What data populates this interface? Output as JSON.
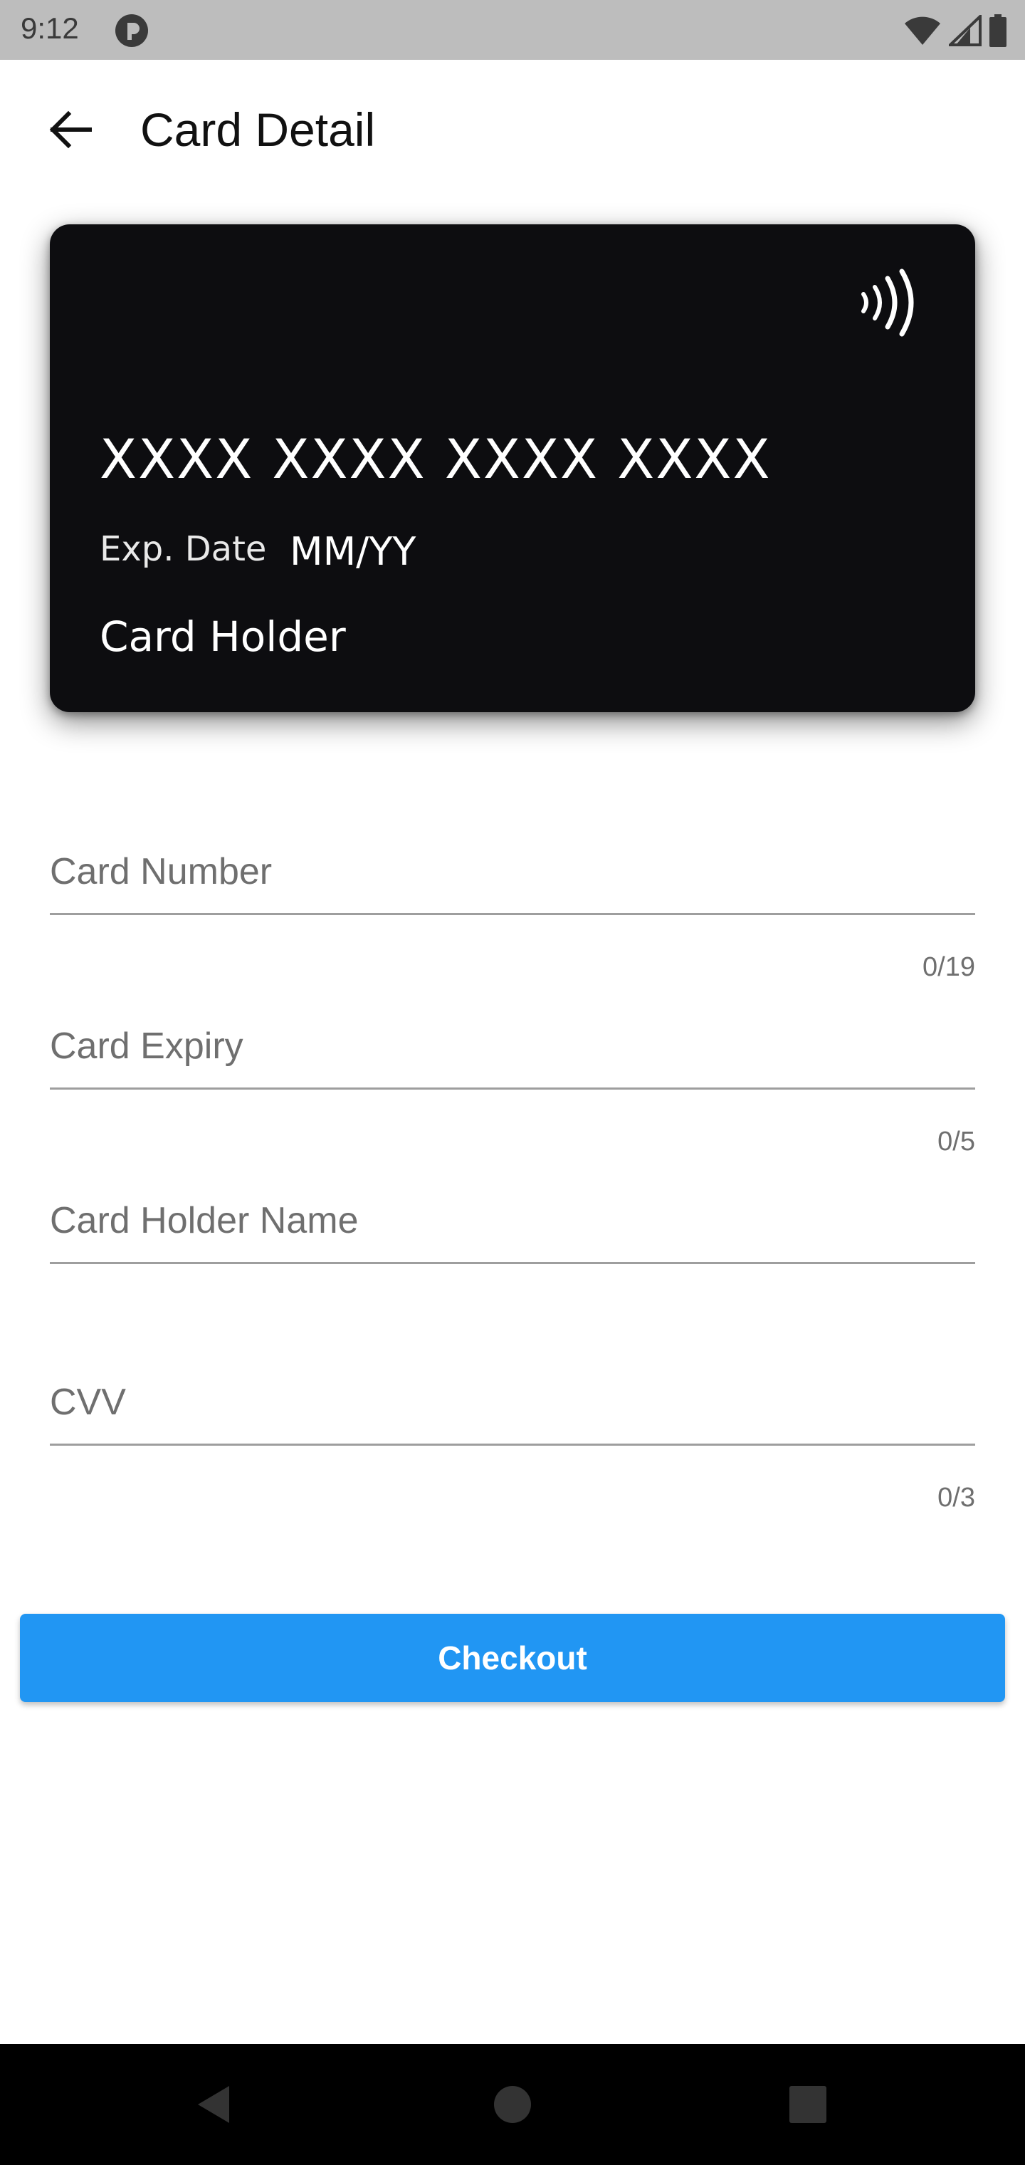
{
  "status_bar": {
    "time": "9:12",
    "icons": [
      "app-notification-icon",
      "wifi-icon",
      "signal-icon",
      "battery-icon"
    ],
    "background": "#bdbdbd"
  },
  "app_bar": {
    "title": "Card Detail",
    "back_icon": "arrow-back-icon"
  },
  "card": {
    "number": "XXXX XXXX XXXX XXXX",
    "exp_label": "Exp. Date",
    "exp_value": "MM/YY",
    "holder": "Card Holder",
    "icon": "contactless-icon",
    "background": "#0d0d10"
  },
  "form": {
    "card_number": {
      "placeholder": "Card Number",
      "value": "",
      "counter": "0/19"
    },
    "card_expiry": {
      "placeholder": "Card Expiry",
      "value": "",
      "counter": "0/5"
    },
    "card_holder_name": {
      "placeholder": "Card Holder Name",
      "value": ""
    },
    "cvv": {
      "placeholder": "CVV",
      "value": "",
      "counter": "0/3"
    }
  },
  "checkout": {
    "label": "Checkout",
    "color": "#2196f3"
  },
  "nav_bar": {
    "icons": [
      "nav-back-icon",
      "nav-home-icon",
      "nav-recents-icon"
    ]
  }
}
